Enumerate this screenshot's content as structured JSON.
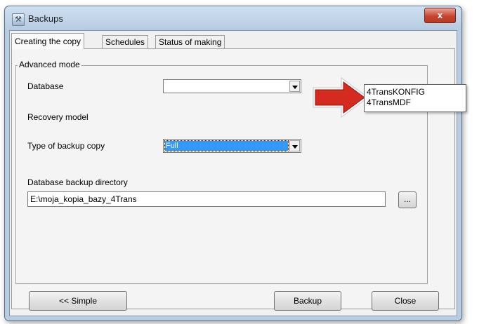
{
  "window": {
    "title": "Backups",
    "close_glyph": "x"
  },
  "tabs": [
    {
      "label": "Creating the copy",
      "active": true
    },
    {
      "label": "Schedules",
      "active": false
    },
    {
      "label": "Status of making",
      "active": false
    }
  ],
  "group": {
    "label": "Advanced mode"
  },
  "fields": {
    "database_label": "Database",
    "database_value": "",
    "recovery_label": "Recovery model",
    "backup_type_label": "Type of backup copy",
    "backup_type_value": "Full",
    "directory_label": "Database backup directory",
    "directory_value": "E:\\moja_kopia_bazy_4Trans",
    "browse_label": "..."
  },
  "buttons": {
    "simple": "<< Simple",
    "backup": "Backup",
    "close": "Close"
  },
  "dropdown_options": [
    "4TransKONFIG",
    "4TransMDF"
  ],
  "colors": {
    "arrow": "#d42a20",
    "selection": "#3399ff",
    "title_bar": "#b8cde2",
    "close_button": "#c7452e"
  }
}
